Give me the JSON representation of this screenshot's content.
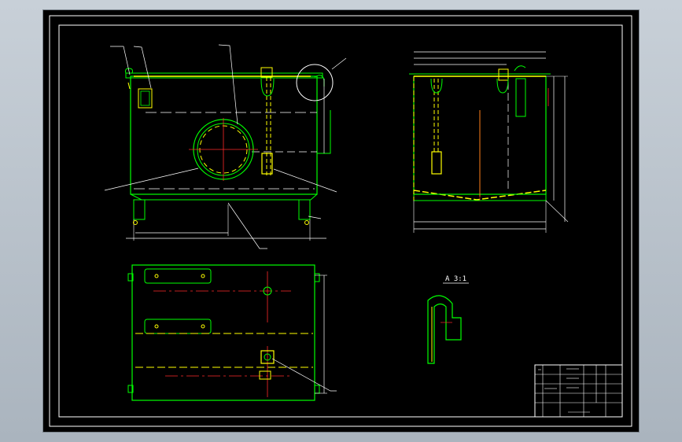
{
  "window": {
    "title": ""
  },
  "drawing": {
    "section_label": "A 3:1",
    "colors": {
      "background": "#000000",
      "border": "#ffffff",
      "outline": "#00ff00",
      "centerline": "#ff2a2a",
      "hidden": "#ffff00",
      "dimension": "#ffffff"
    }
  }
}
